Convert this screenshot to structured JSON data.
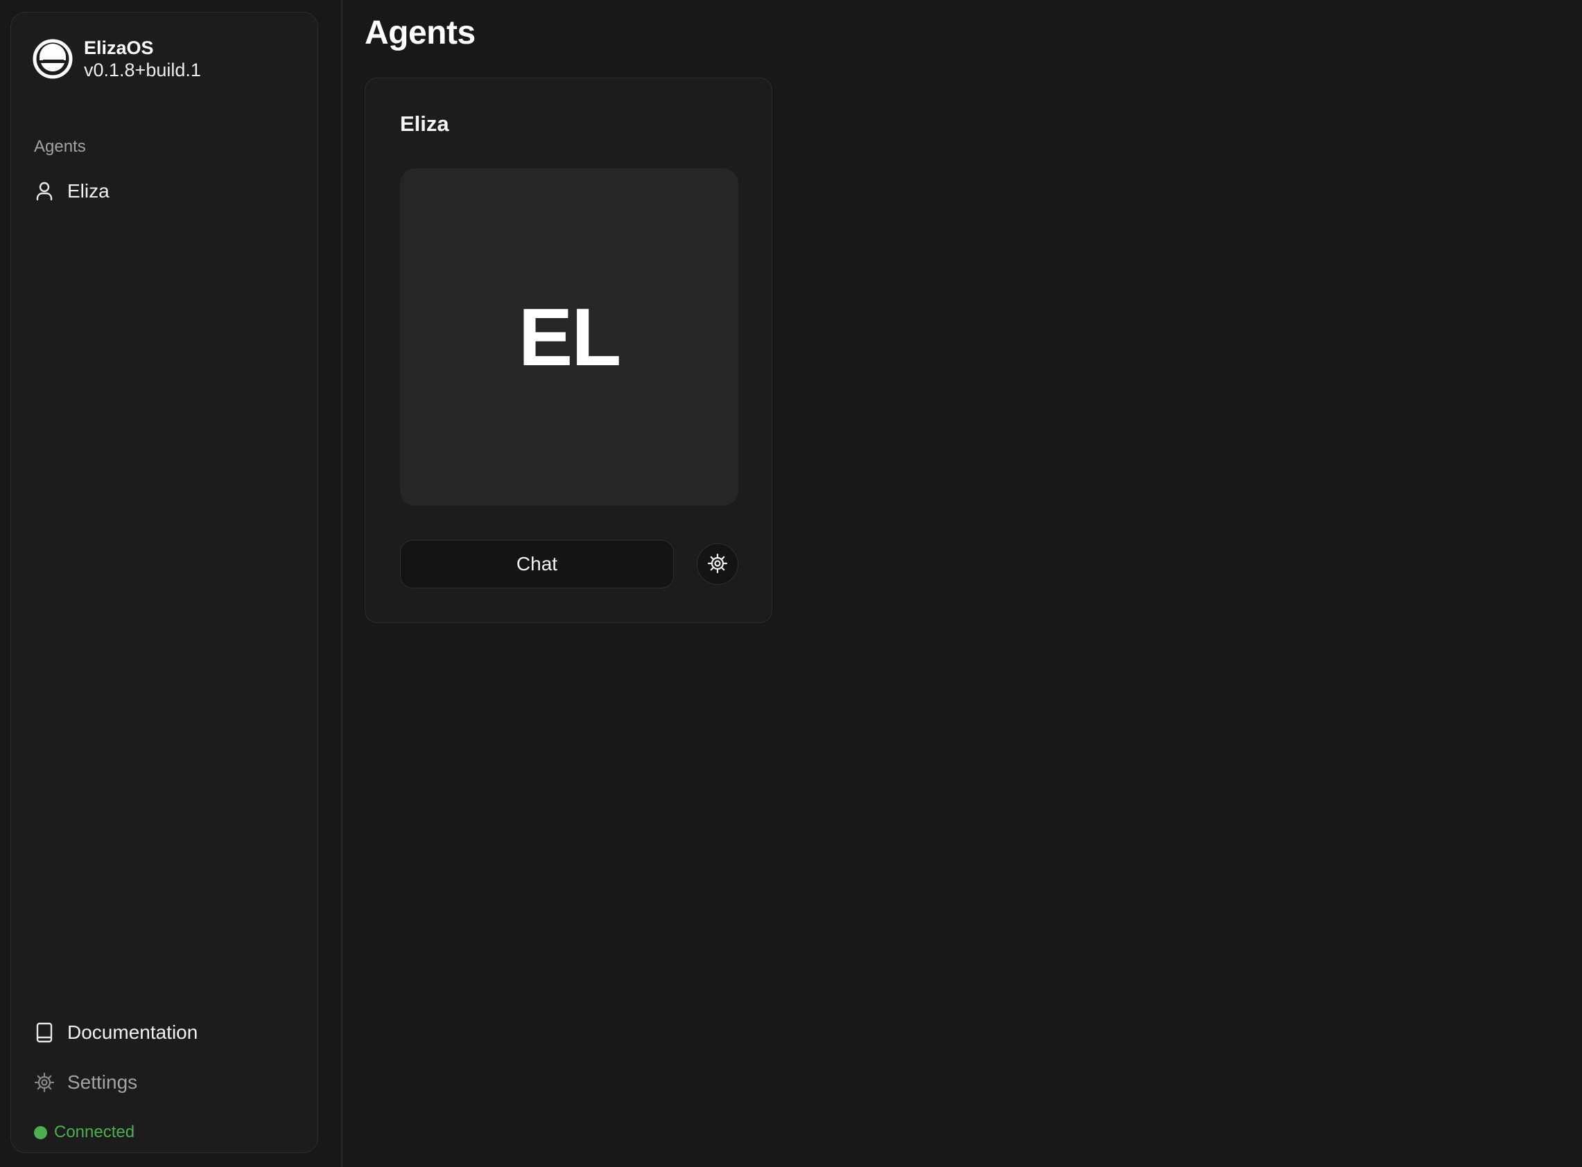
{
  "app": {
    "name": "ElizaOS",
    "version": "v0.1.8+build.1"
  },
  "sidebar": {
    "section_label": "Agents",
    "agents": [
      {
        "label": "Eliza",
        "icon": "user-icon"
      }
    ],
    "footer_items": [
      {
        "label": "Documentation",
        "icon": "book-icon"
      },
      {
        "label": "Settings",
        "icon": "cog-icon"
      }
    ],
    "status": {
      "label": "Connected",
      "color": "#4caf50"
    }
  },
  "main": {
    "title": "Agents",
    "agent_cards": [
      {
        "name": "Eliza",
        "initials": "EL",
        "chat_label": "Chat",
        "settings_icon": "cog-icon"
      }
    ]
  },
  "colors": {
    "background": "#181818",
    "panel": "#1c1c1c",
    "avatar_bg": "#262628",
    "muted_text": "#a3a3a3",
    "status_green": "#4caf50"
  }
}
